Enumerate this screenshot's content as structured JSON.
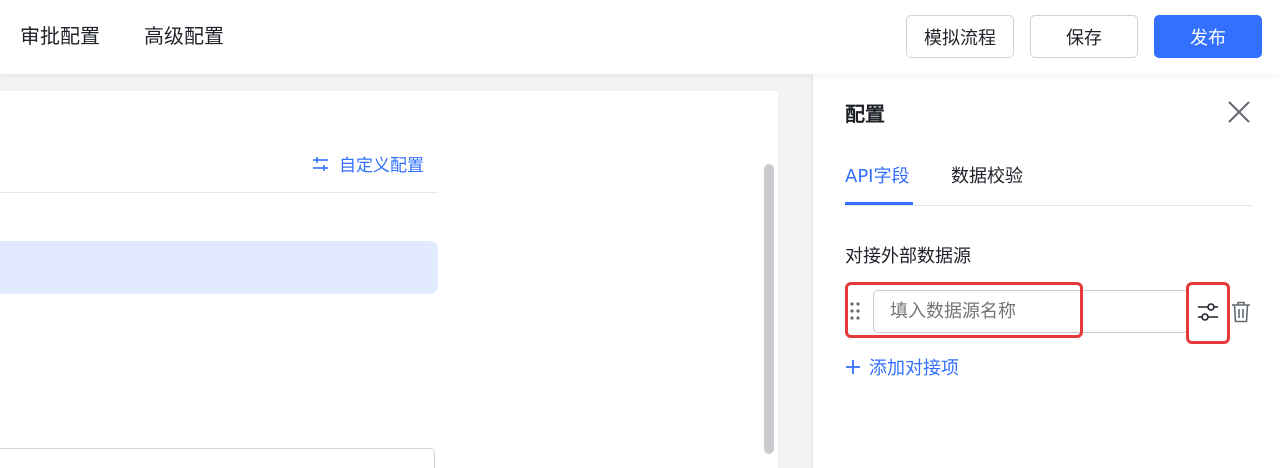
{
  "header": {
    "tabs": [
      {
        "label": "审批配置"
      },
      {
        "label": "高级配置"
      }
    ],
    "buttons": {
      "simulate": "模拟流程",
      "save": "保存",
      "publish": "发布"
    }
  },
  "canvas": {
    "custom_config_label": "自定义配置"
  },
  "panel": {
    "title": "配置",
    "tabs": [
      {
        "label": "API字段",
        "active": true
      },
      {
        "label": "数据校验",
        "active": false
      }
    ],
    "section_label": "对接外部数据源",
    "datasource_input": {
      "value": "",
      "placeholder": "填入数据源名称"
    },
    "add_item_label": "添加对接项"
  },
  "colors": {
    "primary": "#3370ff",
    "highlight_border": "#e63a3a",
    "info_bar": "#e1eaff"
  },
  "icons": {
    "custom_config": "adjust-icon",
    "close": "close-icon",
    "drag": "drag-handle-icon",
    "settings": "sliders-icon",
    "delete": "trash-icon",
    "add": "plus-icon"
  }
}
